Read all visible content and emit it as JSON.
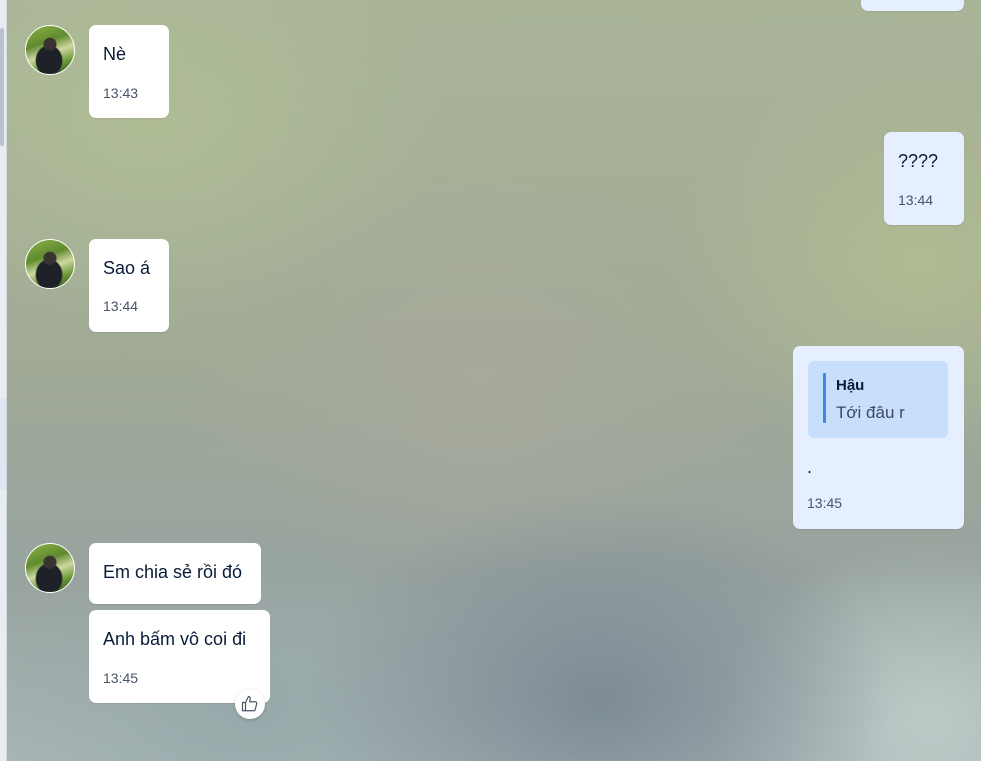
{
  "messages": [
    {
      "side": "in",
      "text": "Nè",
      "time": "13:43"
    },
    {
      "side": "out",
      "text": "????",
      "time": "13:44"
    },
    {
      "side": "in",
      "text": "Sao á",
      "time": "13:44"
    },
    {
      "side": "out",
      "reply_to": {
        "name": "Hậu",
        "text": "Tới đâu r"
      },
      "text": ".",
      "time": "13:45"
    },
    {
      "side": "in",
      "text": "Em chia sẻ rồi đó"
    },
    {
      "side": "in",
      "text": "Anh bấm vô coi đi",
      "time": "13:45"
    }
  ],
  "icons": {
    "avatar": "contact-avatar",
    "reaction": "thumbs-up-icon"
  },
  "colors": {
    "incoming_bubble": "#ffffff",
    "outgoing_bubble": "#e5efff",
    "quote_background": "#c7dffc",
    "quote_bar": "#3d88e0"
  }
}
